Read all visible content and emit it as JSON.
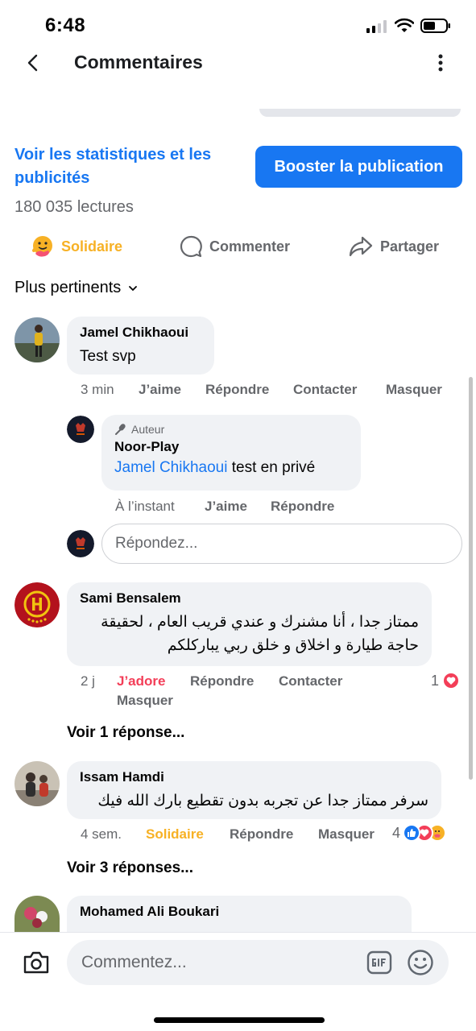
{
  "status": {
    "time": "6:48"
  },
  "header": {
    "title": "Commentaires"
  },
  "stats": {
    "link_label": "Voir les statistiques et les publicités",
    "boost_label": "Booster la publication",
    "reads": "180 035 lectures"
  },
  "actions": {
    "react": "Solidaire",
    "comment": "Commenter",
    "share": "Partager"
  },
  "sort": {
    "label": "Plus pertinents"
  },
  "comments": [
    {
      "name": "Jamel Chikhaoui",
      "text": "Test svp",
      "time": "3 min",
      "like": "J’aime",
      "reply": "Répondre",
      "contact": "Contacter",
      "hide": "Masquer"
    },
    {
      "badge": "Auteur",
      "name": "Noor-Play",
      "mention": "Jamel Chikhaoui",
      "text": " test en privé",
      "time": "À l’instant",
      "like": "J’aime",
      "reply": "Répondre"
    },
    {
      "name": "Sami Bensalem",
      "text": "ممتاز جدا ، أنا مشنرك و عندي قريب العام ، لحقيقة حاجة طيارة و اخلاق و خلق ربي يباركلكم",
      "time": "2 j",
      "like": "J’adore",
      "reply": "Répondre",
      "contact": "Contacter",
      "hide": "Masquer",
      "reactions": "1",
      "view_replies": "Voir 1 réponse..."
    },
    {
      "name": "Issam Hamdi",
      "text": "سرفر ممتاز جدا عن تجربه بدون تقطيع بارك الله فيك",
      "time": "4 sem.",
      "like": "Solidaire",
      "reply": "Répondre",
      "hide": "Masquer",
      "reactions": "4",
      "view_replies": "Voir 3 réponses..."
    },
    {
      "name": "Mohamed Ali Boukari"
    }
  ],
  "reply_input": {
    "placeholder": "Répondez..."
  },
  "composer": {
    "placeholder": "Commentez..."
  },
  "colors": {
    "accent": "#1877f2",
    "love": "#f33e58",
    "care": "#f7b125",
    "bubble": "#f0f2f5",
    "secondary_text": "#65676b"
  }
}
